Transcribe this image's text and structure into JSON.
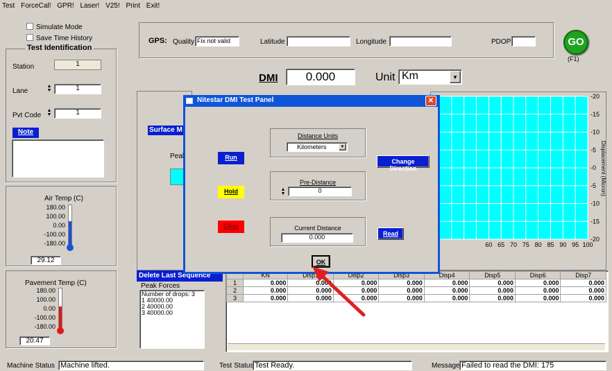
{
  "menu": [
    "Test",
    "ForceCal!",
    "GPR!",
    "Laser!",
    "V25!",
    "Print",
    "Exit!"
  ],
  "left_panel": {
    "simulate_label": "Simulate Mode",
    "save_history_label": "Save Time History",
    "test_id_title": "Test Identification",
    "station_label": "Station",
    "station_value": "1",
    "lane_label": "Lane",
    "lane_value": "1",
    "pvt_label": "Pvt Code",
    "pvt_value": "1",
    "note_label": "Note",
    "air_temp": {
      "title": "Air Temp (C)",
      "ticks": [
        "180.00",
        "100.00",
        "0.00",
        "-100.00",
        "-180.00"
      ],
      "value": "29.12",
      "level": 0.6
    },
    "pave_temp": {
      "title": "Pavement Temp (C)",
      "ticks": [
        "180.00",
        "100.00",
        "0.00",
        "-100.00",
        "-180.00"
      ],
      "value": "20.47",
      "level": 0.55
    }
  },
  "gps": {
    "label": "GPS:",
    "quality_label": "Quality",
    "quality_value": "Fix not valid",
    "latitude_label": "Latitude",
    "longitude_label": "Longitude",
    "pdop_label": "PDOP"
  },
  "go": {
    "label": "GO",
    "hint": "(F1)"
  },
  "dmi": {
    "label": "DMI",
    "value": "0.000",
    "unit_label": "Unit",
    "unit_value": "Km"
  },
  "surface": {
    "label_partial": "Surface M",
    "peak_partial": "Peak"
  },
  "chart": {
    "y_ticks": [
      "-20",
      "-15",
      "-10",
      "-5",
      "-0",
      "-5",
      "-10",
      "-15",
      "-20"
    ],
    "x_ticks": [
      "60",
      "65",
      "70",
      "75",
      "80",
      "85",
      "90",
      "95",
      "100"
    ],
    "y_label": "Displacement (Micron)",
    "bg": "#00ffff"
  },
  "dialog": {
    "title": "Nitestar DMI Test Panel",
    "run": "Run",
    "hold": "Hold",
    "clear": "Clear",
    "distance_units_label": "Distance Units",
    "distance_units_value": "Kilometers",
    "change_direction": "Change Direction",
    "pre_distance_label": "Pre-Distance",
    "pre_distance_value": "0",
    "current_distance_label": "Current Distance",
    "current_distance_value": "0.000",
    "read": "Read",
    "ok": "OK"
  },
  "delete_last": "Delete Last Sequence",
  "peak_forces": {
    "title": "Peak Forces",
    "lines": [
      "Number of drops: 3",
      "1   40000.00",
      "2   40000.00",
      "3   40000.00"
    ]
  },
  "grid": {
    "headers": [
      "KN",
      "Disp1",
      "Disp2",
      "Disp3",
      "Disp4",
      "Disp5",
      "Disp6",
      "Disp7"
    ],
    "rows": [
      {
        "n": "1",
        "cells": [
          "0.000",
          "0.000",
          "0.000",
          "0.000",
          "0.000",
          "0.000",
          "0.000",
          "0.000"
        ]
      },
      {
        "n": "2",
        "cells": [
          "0.000",
          "0.000",
          "0.000",
          "0.000",
          "0.000",
          "0.000",
          "0.000",
          "0.000"
        ]
      },
      {
        "n": "3",
        "cells": [
          "0.000",
          "0.000",
          "0.000",
          "0.000",
          "0.000",
          "0.000",
          "0.000",
          "0.000"
        ]
      }
    ]
  },
  "status": {
    "machine_label": "Machine Status",
    "machine_value": "Machine lifted.",
    "test_label": "Test Status",
    "test_value": "Test Ready.",
    "message_label": "Message",
    "message_value": "Failed to read the DMI: 175"
  },
  "colors": {
    "dialog_blue": "#0f55d8",
    "hold": "#ffff00",
    "clear": "#ff0000",
    "arrow": "#e02020",
    "go": "#1fa31f"
  }
}
